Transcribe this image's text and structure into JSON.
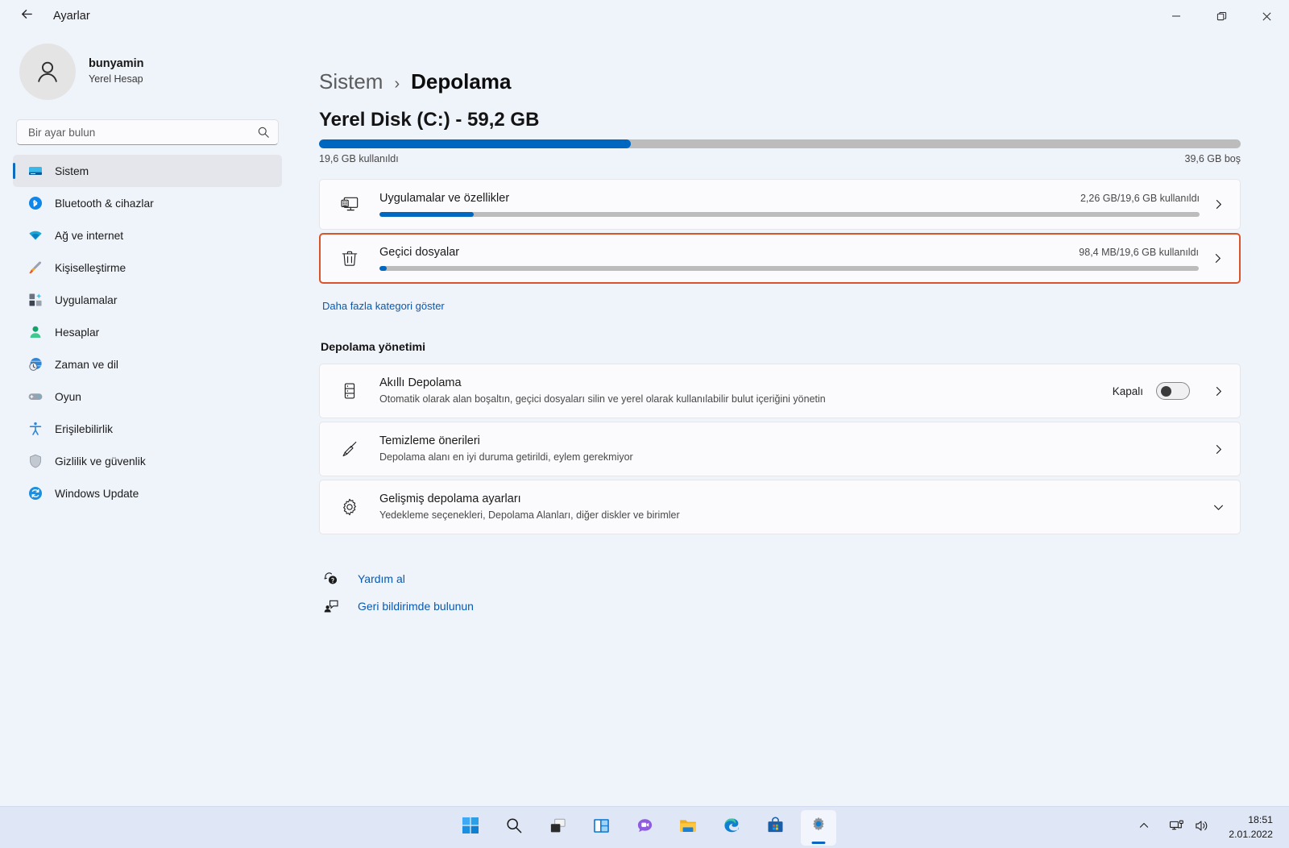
{
  "window": {
    "title": "Ayarlar",
    "back_icon": "back-arrow-icon",
    "minimize_label": "─",
    "maximize_label": "❐",
    "close_label": "✕"
  },
  "account": {
    "name": "bunyamin",
    "type": "Yerel Hesap"
  },
  "search": {
    "placeholder": "Bir ayar bulun",
    "value": "",
    "icon": "search-icon"
  },
  "sidebar": {
    "items": [
      {
        "label": "Sistem",
        "icon": "monitor-icon",
        "selected": true
      },
      {
        "label": "Bluetooth & cihazlar",
        "icon": "bluetooth-icon",
        "selected": false
      },
      {
        "label": "Ağ ve internet",
        "icon": "wifi-icon",
        "selected": false
      },
      {
        "label": "Kişiselleştirme",
        "icon": "brush-icon",
        "selected": false
      },
      {
        "label": "Uygulamalar",
        "icon": "apps-icon",
        "selected": false
      },
      {
        "label": "Hesaplar",
        "icon": "person-icon",
        "selected": false
      },
      {
        "label": "Zaman ve dil",
        "icon": "clock-globe-icon",
        "selected": false
      },
      {
        "label": "Oyun",
        "icon": "gamepad-icon",
        "selected": false
      },
      {
        "label": "Erişilebilirlik",
        "icon": "accessibility-icon",
        "selected": false
      },
      {
        "label": "Gizlilik ve güvenlik",
        "icon": "shield-icon",
        "selected": false
      },
      {
        "label": "Windows Update",
        "icon": "update-icon",
        "selected": false
      }
    ]
  },
  "breadcrumb": {
    "parent": "Sistem",
    "separator": "›",
    "current": "Depolama"
  },
  "disk": {
    "title": "Yerel Disk (C:) - 59,2 GB",
    "used_label": "19,6 GB kullanıldı",
    "free_label": "39,6 GB boş",
    "fill_percent": 33.8
  },
  "categories": [
    {
      "title": "Uygulamalar ve özellikler",
      "value": "2,26 GB/19,6 GB kullanıldı",
      "icon": "app-window-icon",
      "fill_percent": 11.5,
      "highlighted": false
    },
    {
      "title": "Geçici dosyalar",
      "value": "98,4 MB/19,6 GB kullanıldı",
      "icon": "trash-icon",
      "fill_percent": 0.9,
      "highlighted": true
    }
  ],
  "more_categories_link": "Daha fazla kategori göster",
  "management": {
    "heading": "Depolama yönetimi",
    "rows": [
      {
        "title": "Akıllı Depolama",
        "sub": "Otomatik olarak alan boşaltın, geçici dosyaları silin ve yerel olarak kullanılabilir bulut içeriğini yönetin",
        "icon": "storage-sense-icon",
        "toggle_label": "Kapalı",
        "toggle_on": false,
        "chevron": "chevron-right-icon"
      },
      {
        "title": "Temizleme önerileri",
        "sub": "Depolama alanı en iyi duruma getirildi, eylem gerekmiyor",
        "icon": "broom-icon",
        "toggle_label": null,
        "toggle_on": null,
        "chevron": "chevron-right-icon"
      },
      {
        "title": "Gelişmiş depolama ayarları",
        "sub": "Yedekleme seçenekleri, Depolama Alanları, diğer diskler ve birimler",
        "icon": "gear-icon",
        "toggle_label": null,
        "toggle_on": null,
        "chevron": "chevron-down-icon"
      }
    ]
  },
  "footer_links": [
    {
      "label": "Yardım al",
      "icon": "help-icon"
    },
    {
      "label": "Geri bildirimde bulunun",
      "icon": "feedback-icon"
    }
  ],
  "taskbar": {
    "items": [
      {
        "name": "start-button",
        "icon": "windows-logo-icon",
        "active": false
      },
      {
        "name": "search-button",
        "icon": "search-icon",
        "active": false
      },
      {
        "name": "task-view-button",
        "icon": "task-view-icon",
        "active": false
      },
      {
        "name": "widgets-button",
        "icon": "widgets-icon",
        "active": false
      },
      {
        "name": "chat-button",
        "icon": "chat-video-icon",
        "active": false
      },
      {
        "name": "file-explorer-button",
        "icon": "folder-icon",
        "active": false
      },
      {
        "name": "edge-button",
        "icon": "edge-icon",
        "active": false
      },
      {
        "name": "microsoft-store-button",
        "icon": "store-icon",
        "active": false
      },
      {
        "name": "settings-button",
        "icon": "gear-icon",
        "active": true
      }
    ],
    "tray": {
      "chevron": "chevron-up-icon",
      "network": "network-icon",
      "volume": "volume-icon",
      "time": "18:51",
      "date": "2.01.2022"
    }
  },
  "colors": {
    "accent": "#0067c0",
    "highlight": "#d9542b",
    "link": "#0a59b0",
    "page_bg": "#eff3fa",
    "card_bg": "#fbfbfd"
  }
}
